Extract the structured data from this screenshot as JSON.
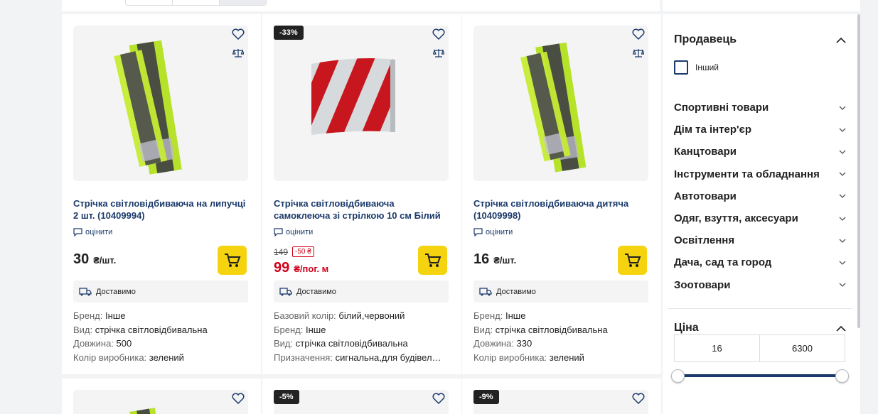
{
  "products": [
    {
      "badge": "",
      "title": "Стрічка світловідбиваюча на липучці 2 шт. (10409994)",
      "rate": "оцінити",
      "old_price": "",
      "discount": "",
      "price": "30",
      "unit": "₴/шт.",
      "delivery": "Доставимо",
      "specs": [
        {
          "k": "Бренд:",
          "v": "Інше"
        },
        {
          "k": "Вид:",
          "v": "стрічка світловідбивальна"
        },
        {
          "k": "Довжина:",
          "v": "500"
        },
        {
          "k": "Колір виробника:",
          "v": "зелений"
        }
      ]
    },
    {
      "badge": "-33%",
      "title": "Стрічка світловідбиваюча самоклеюча зі стрілкою 10 см Білий …",
      "rate": "оцінити",
      "old_price": "149",
      "discount": "-50 ₴",
      "price": "99",
      "unit": "₴/пог. м",
      "delivery": "Доставимо",
      "specs": [
        {
          "k": "Базовий колір:",
          "v": "білий,червоний"
        },
        {
          "k": "Бренд:",
          "v": "Інше"
        },
        {
          "k": "Вид:",
          "v": "стрічка світловідбивальна"
        },
        {
          "k": "Призначення:",
          "v": "сигнальна,для будівел…"
        }
      ]
    },
    {
      "badge": "",
      "title": "Стрічка світловідбиваюча дитяча (10409998)",
      "rate": "оцінити",
      "old_price": "",
      "discount": "",
      "price": "16",
      "unit": "₴/шт.",
      "delivery": "Доставимо",
      "specs": [
        {
          "k": "Бренд:",
          "v": "Інше"
        },
        {
          "k": "Вид:",
          "v": "стрічка світловідбивальна"
        },
        {
          "k": "Довжина:",
          "v": "330"
        },
        {
          "k": "Колір виробника:",
          "v": "зелений"
        }
      ]
    }
  ],
  "next_row_badges": [
    "",
    "-5%",
    "-9%"
  ],
  "filters": {
    "seller": {
      "title": "Продавець",
      "option": "Інший"
    },
    "categories": [
      "Спортивні товари",
      "Дім та інтер'єр",
      "Канцтовари",
      "Інструменти та обладнання",
      "Автотовари",
      "Одяг, взуття, аксесуари",
      "Освітлення",
      "Дача, сад та город",
      "Зоотовари"
    ],
    "price": {
      "title": "Ціна",
      "min": "16",
      "max": "6300"
    }
  },
  "colors": {
    "accent_yellow": "#f5d40f",
    "title_blue": "#1b3a6b",
    "sale_red": "#d0021b"
  }
}
